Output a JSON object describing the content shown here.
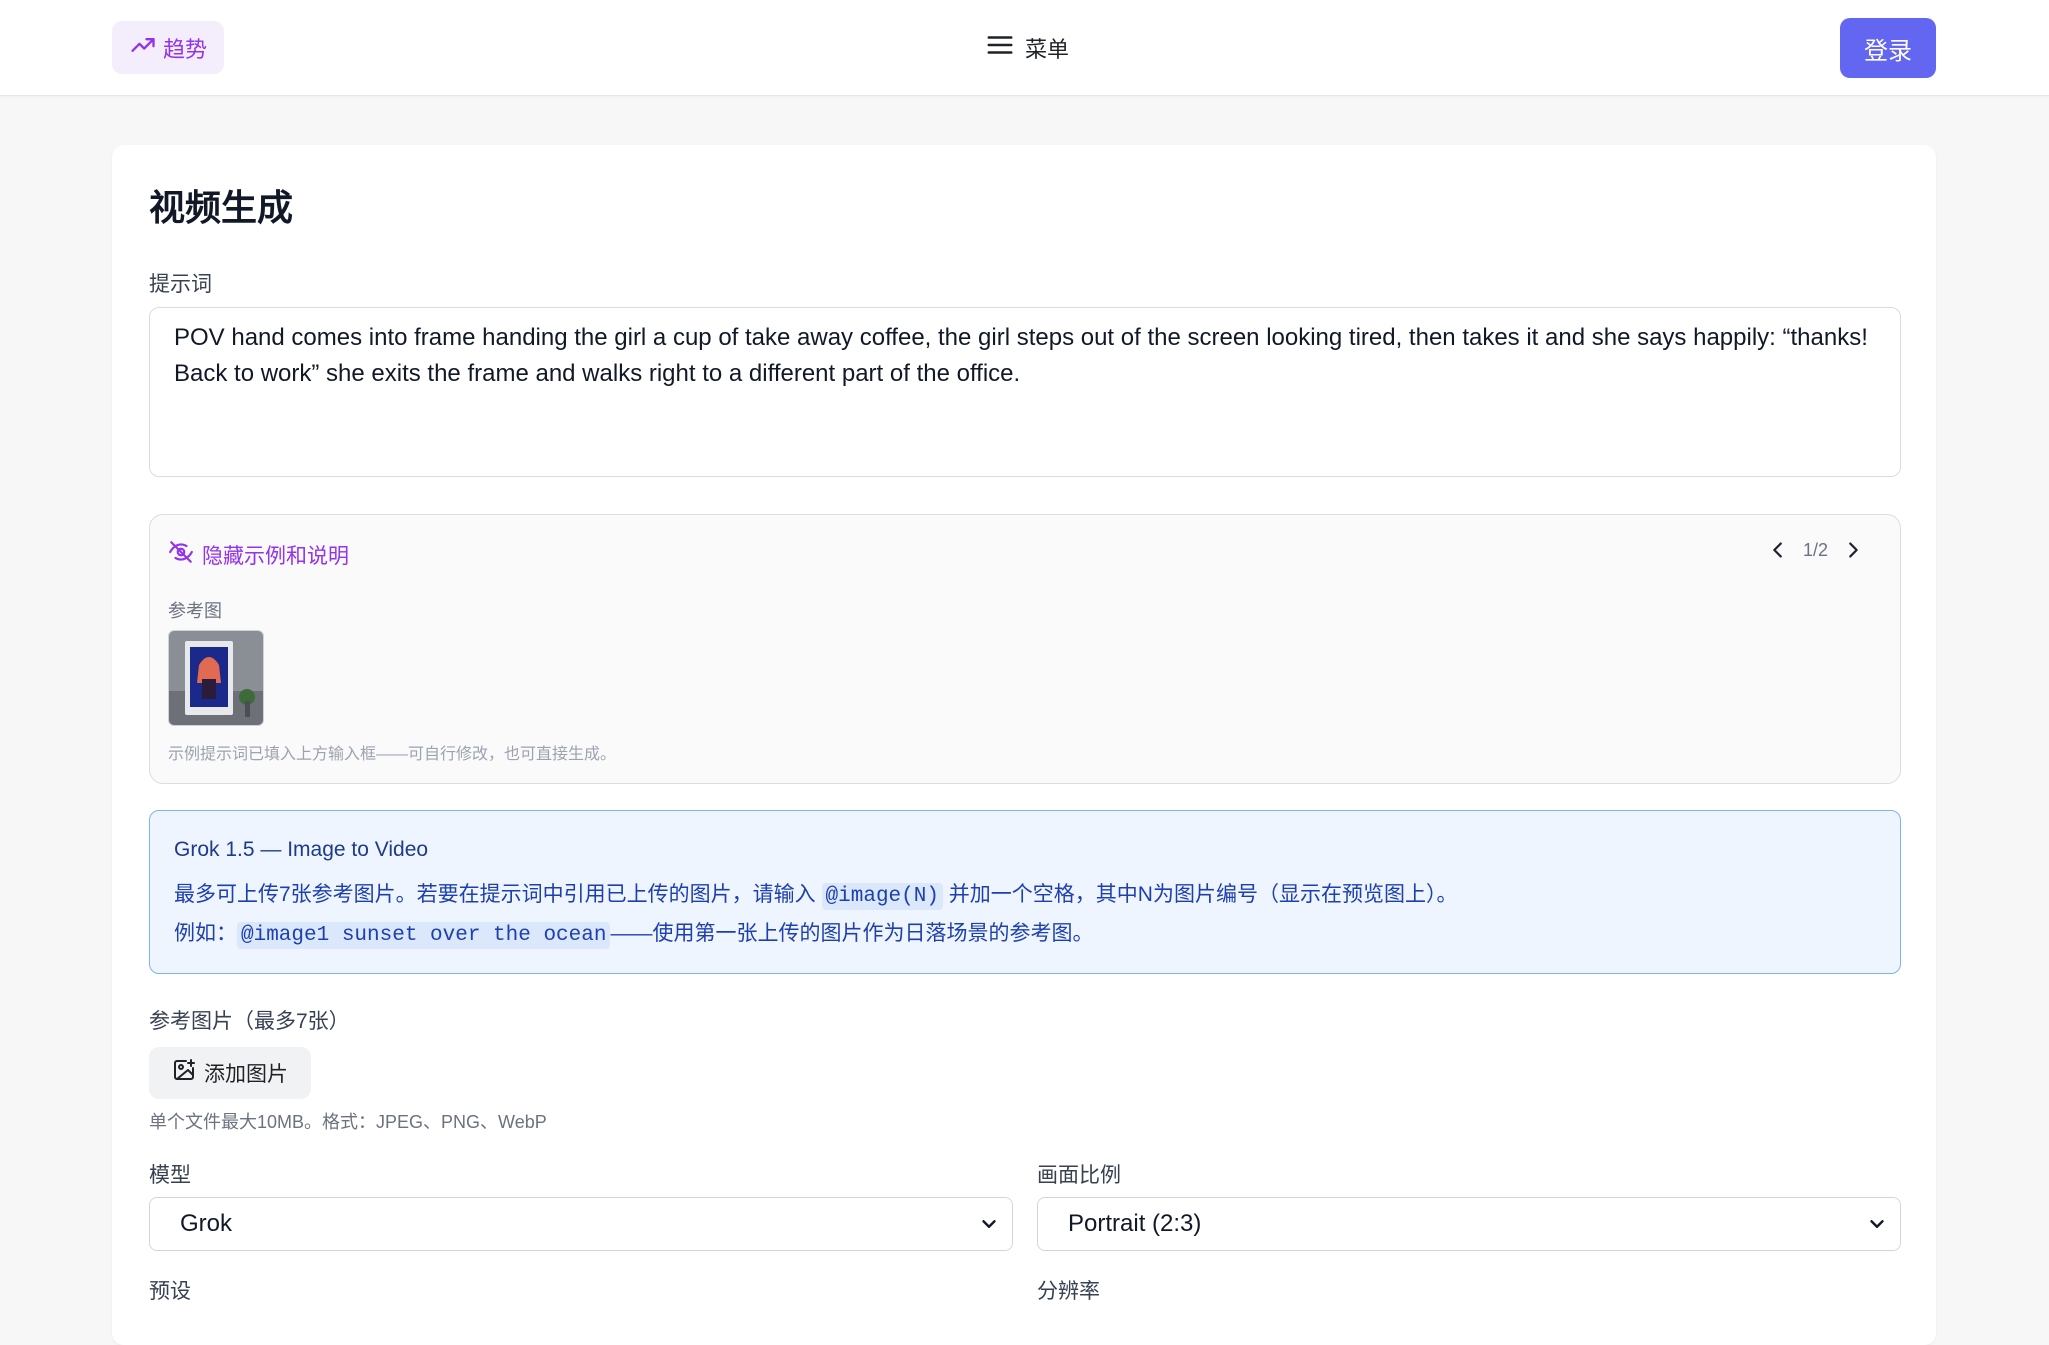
{
  "nav": {
    "trend_label": "趋势",
    "menu_label": "菜单",
    "login_label": "登录"
  },
  "page": {
    "title": "视频生成",
    "prompt_label": "提示词",
    "prompt_value": "POV hand comes into frame handing the girl a cup of take away coffee, the girl steps out of the screen looking tired, then takes it and she says happily: “thanks! Back to work” she exits the frame and walks right to a different part of the office."
  },
  "examples": {
    "hide_label": "隐藏示例和说明",
    "pager": "1/2",
    "ref_label": "参考图",
    "note": "示例提示词已填入上方输入框——可自行修改，也可直接生成。"
  },
  "info": {
    "title": "Grok 1.5 — Image to Video",
    "line2_before": "最多可上传7张参考图片。若要在提示词中引用已上传的图片，请输入",
    "line2_code": "@image(N)",
    "line2_after": "并加一个空格，其中N为图片编号（显示在预览图上）。",
    "line3_before": "例如：",
    "line3_code": "@image1 sunset over the ocean",
    "line3_after": "——使用第一张上传的图片作为日落场景的参考图。"
  },
  "upload": {
    "label": "参考图片（最多7张）",
    "button_label": "添加图片",
    "note": "单个文件最大10MB。格式：JPEG、PNG、WebP"
  },
  "model": {
    "label": "模型",
    "selected": "Grok"
  },
  "aspect": {
    "label": "画面比例",
    "selected": "Portrait (2:3)"
  },
  "bottom_labels": {
    "preset": "预设",
    "resolution": "分辨率"
  },
  "colors": {
    "accent": "#6366f1",
    "purple": "#9333ea",
    "info_border": "#7cb4ee",
    "info_bg": "#eef5ff"
  }
}
